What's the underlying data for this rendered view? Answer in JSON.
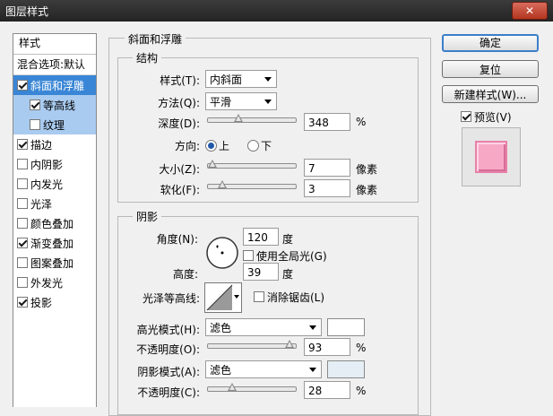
{
  "window": {
    "title": "图层样式"
  },
  "sidebar": {
    "header": "样式",
    "blend_options": "混合选项:默认",
    "items": [
      {
        "label": "斜面和浮雕",
        "checked": true,
        "level": 0,
        "state": "selected"
      },
      {
        "label": "等高线",
        "checked": true,
        "level": 1,
        "state": "sub"
      },
      {
        "label": "纹理",
        "checked": false,
        "level": 1,
        "state": "sub"
      },
      {
        "label": "描边",
        "checked": true,
        "level": 0,
        "state": ""
      },
      {
        "label": "内阴影",
        "checked": false,
        "level": 0,
        "state": ""
      },
      {
        "label": "内发光",
        "checked": false,
        "level": 0,
        "state": ""
      },
      {
        "label": "光泽",
        "checked": false,
        "level": 0,
        "state": ""
      },
      {
        "label": "颜色叠加",
        "checked": false,
        "level": 0,
        "state": ""
      },
      {
        "label": "渐变叠加",
        "checked": true,
        "level": 0,
        "state": ""
      },
      {
        "label": "图案叠加",
        "checked": false,
        "level": 0,
        "state": ""
      },
      {
        "label": "外发光",
        "checked": false,
        "level": 0,
        "state": ""
      },
      {
        "label": "投影",
        "checked": true,
        "level": 0,
        "state": ""
      }
    ]
  },
  "bevel": {
    "group_title": "斜面和浮雕",
    "structure": {
      "title": "结构",
      "style_label": "样式(T):",
      "style_value": "内斜面",
      "technique_label": "方法(Q):",
      "technique_value": "平滑",
      "depth_label": "深度(D):",
      "depth_value": "348",
      "depth_unit": "%",
      "depth_fraction": 0.35,
      "direction_label": "方向:",
      "direction_up": "上",
      "direction_down": "下",
      "direction_selected": "up",
      "size_label": "大小(Z):",
      "size_value": "7",
      "size_unit": "像素",
      "size_fraction": 0.05,
      "soften_label": "软化(F):",
      "soften_value": "3",
      "soften_unit": "像素",
      "soften_fraction": 0.16
    },
    "shading": {
      "title": "阴影",
      "angle_label": "角度(N):",
      "angle_value": "120",
      "angle_unit": "度",
      "global_light_label": "使用全局光(G)",
      "global_light_checked": false,
      "altitude_label": "高度:",
      "altitude_value": "39",
      "altitude_unit": "度",
      "gloss_label": "光泽等高线:",
      "antialias_label": "消除锯齿(L)",
      "antialias_checked": false,
      "highlight_mode_label": "高光模式(H):",
      "highlight_mode_value": "滤色",
      "highlight_color": "#ffffff",
      "highlight_opacity_label": "不透明度(O):",
      "highlight_opacity_value": "93",
      "highlight_opacity_unit": "%",
      "highlight_opacity_fraction": 0.93,
      "shadow_mode_label": "阴影模式(A):",
      "shadow_mode_value": "滤色",
      "shadow_color": "#e4eef4",
      "shadow_opacity_label": "不透明度(C):",
      "shadow_opacity_value": "28",
      "shadow_opacity_unit": "%",
      "shadow_opacity_fraction": 0.28
    }
  },
  "buttons": {
    "ok": "确定",
    "reset": "复位",
    "new_style": "新建样式(W)...",
    "preview_label": "预览(V)",
    "preview_checked": true
  },
  "colors": {
    "selected_item": "#3a86d6",
    "preview_swatch": "#f7a8c5"
  }
}
